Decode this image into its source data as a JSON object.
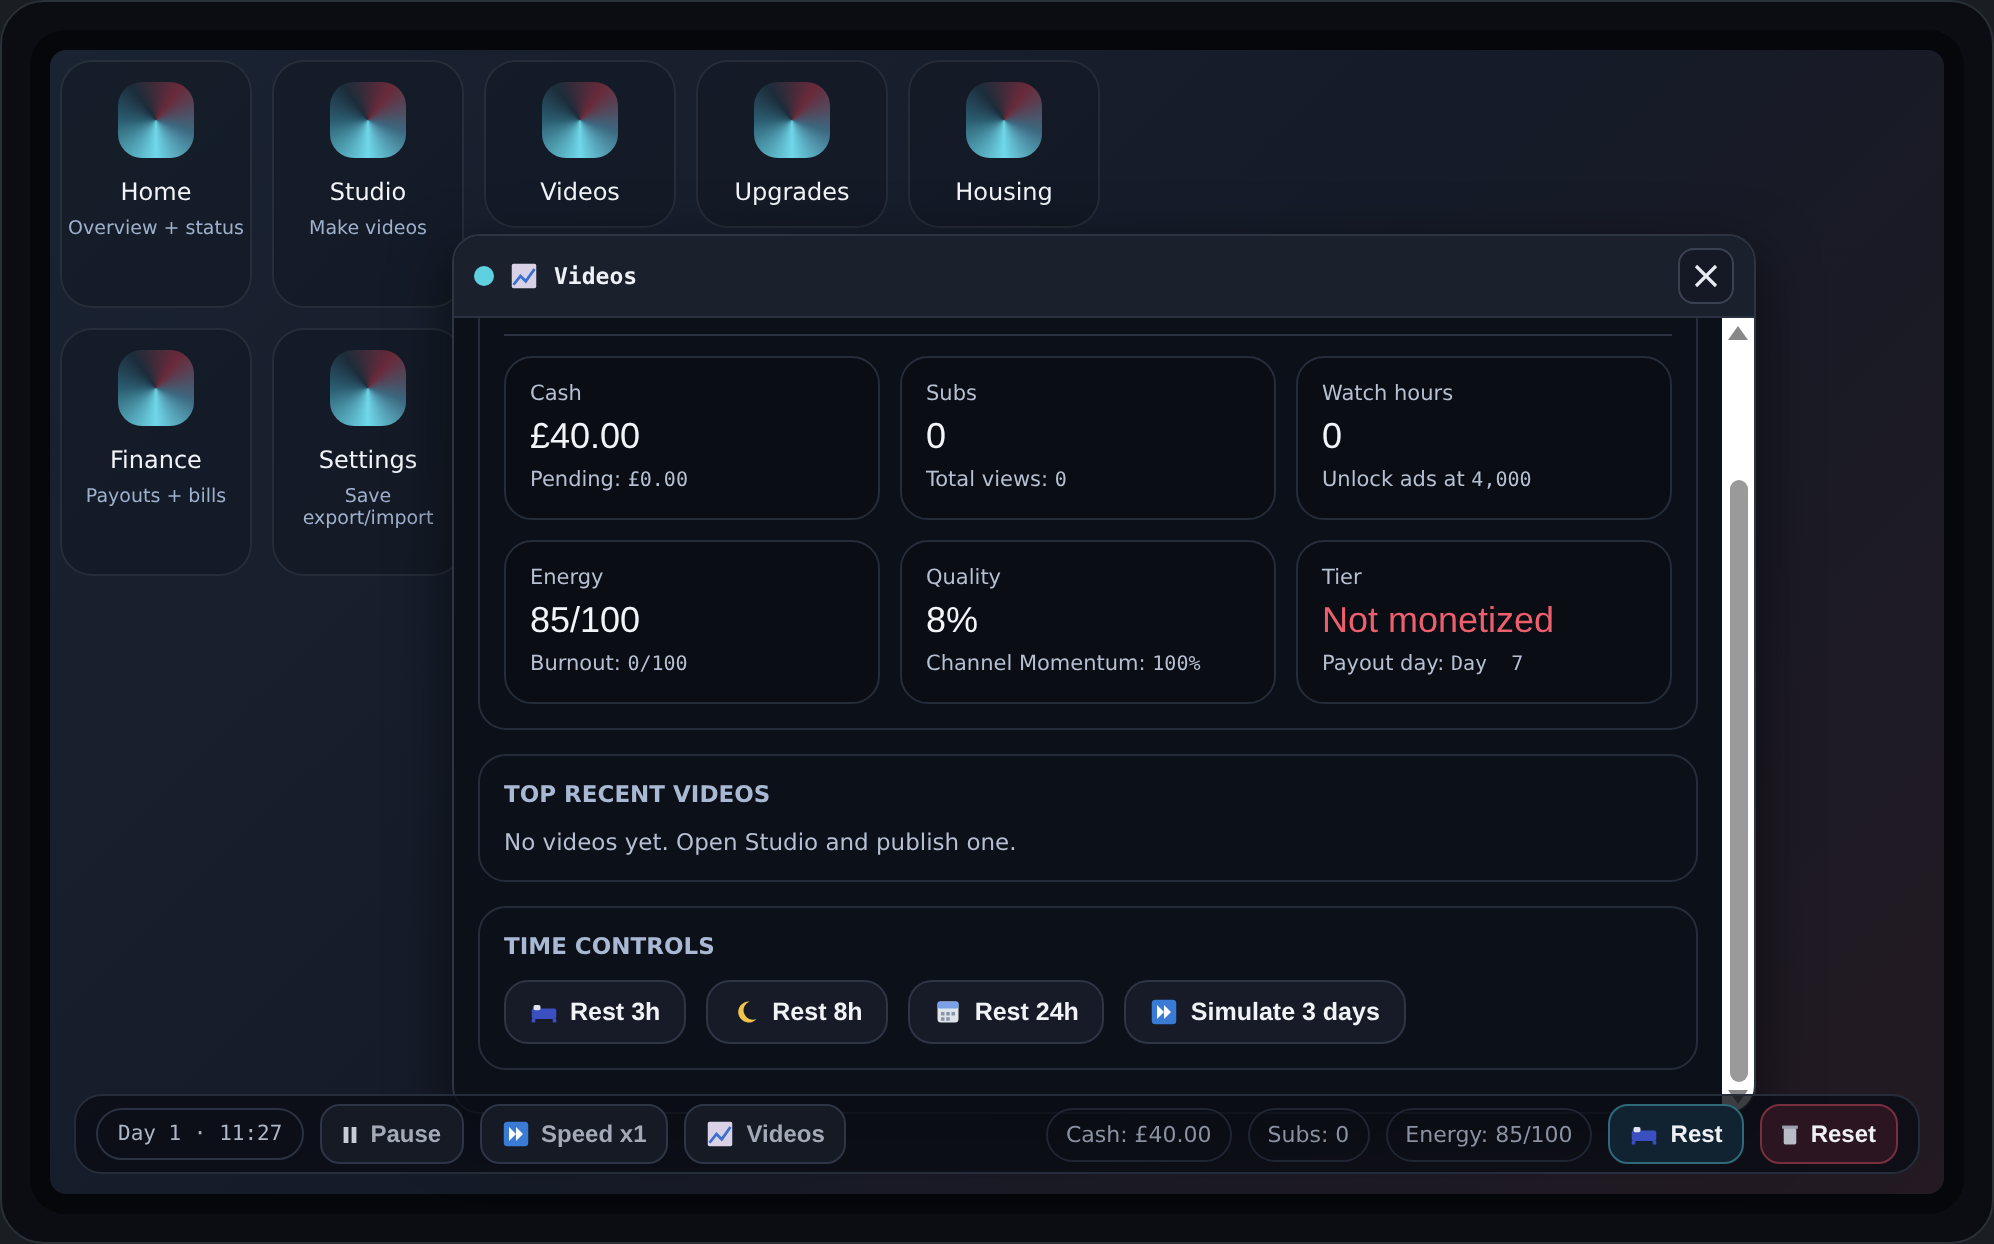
{
  "apps": [
    {
      "label": "Home",
      "subtitle": "Overview + status"
    },
    {
      "label": "Studio",
      "subtitle": "Make videos"
    },
    {
      "label": "Videos"
    },
    {
      "label": "Upgrades"
    },
    {
      "label": "Housing"
    },
    {
      "label": "Finance",
      "subtitle": "Payouts + bills"
    },
    {
      "label": "Settings",
      "subtitle": "Save export/import"
    }
  ],
  "window": {
    "title": "Videos",
    "stats": [
      {
        "label": "Cash",
        "value": "£40.00",
        "note_label": "Pending:",
        "note_value": "£0.00",
        "alert": false
      },
      {
        "label": "Subs",
        "value": "0",
        "note_label": "Total views:",
        "note_value": "0",
        "alert": false
      },
      {
        "label": "Watch hours",
        "value": "0",
        "note_label": "Unlock ads at",
        "note_value": "4,000",
        "alert": false
      },
      {
        "label": "Energy",
        "value": "85/100",
        "note_label": "Burnout:",
        "note_value": "0/100",
        "alert": false
      },
      {
        "label": "Quality",
        "value": "8%",
        "note_label": "Channel Momentum:",
        "note_value": "100%",
        "alert": false
      },
      {
        "label": "Tier",
        "value": "Not monetized",
        "note_label": "Payout day:",
        "note_value": "Day  7",
        "alert": true
      }
    ],
    "recent": {
      "heading": "TOP RECENT VIDEOS",
      "text": "No videos yet. Open Studio and publish one."
    },
    "time_controls": {
      "heading": "TIME CONTROLS",
      "buttons": [
        {
          "kind": "bed",
          "label": "Rest 3h"
        },
        {
          "kind": "moon",
          "label": "Rest 8h"
        },
        {
          "kind": "calendar",
          "label": "Rest 24h"
        },
        {
          "kind": "fastforward",
          "label": "Simulate 3 days"
        }
      ]
    }
  },
  "dock": {
    "clock": "Day 1 · 11:27",
    "left_buttons": [
      {
        "kind": "pause",
        "label": "Pause"
      },
      {
        "kind": "fastforward",
        "label": "Speed x1"
      },
      {
        "kind": "chart",
        "label": "Videos"
      }
    ],
    "readouts": [
      "Cash: £40.00",
      "Subs: 0",
      "Energy: 85/100"
    ],
    "right_buttons": [
      {
        "kind": "rest",
        "label": "Rest"
      },
      {
        "kind": "reset",
        "label": "Reset"
      }
    ]
  }
}
